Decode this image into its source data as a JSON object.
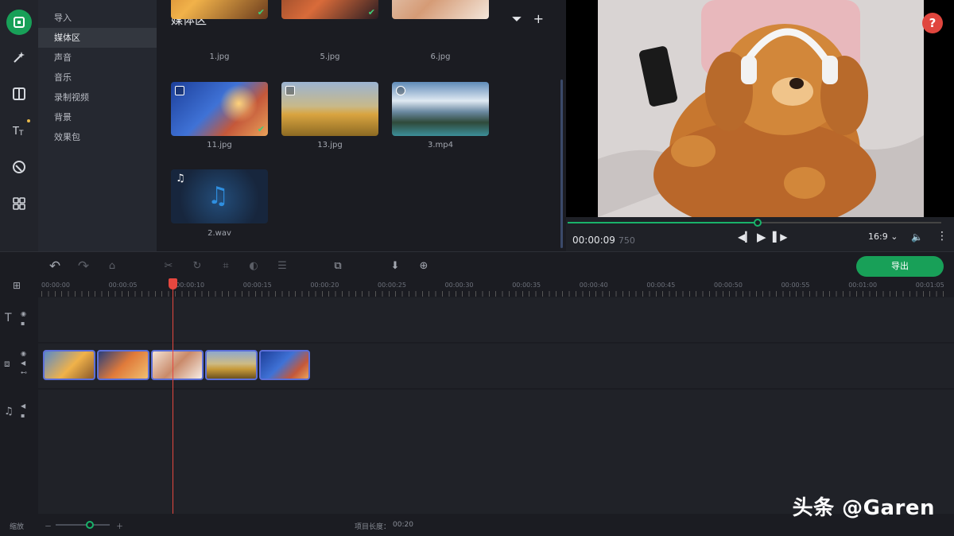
{
  "sidebar": {
    "categories": [
      "导入",
      "媒体区",
      "声音",
      "音乐",
      "录制视频",
      "背景",
      "效果包"
    ],
    "active_index": 1
  },
  "media": {
    "title": "媒体区",
    "items": [
      {
        "name": "1.jpg",
        "checked": true
      },
      {
        "name": "5.jpg",
        "checked": true
      },
      {
        "name": "6.jpg",
        "checked": false
      },
      {
        "name": "11.jpg",
        "checked": true
      },
      {
        "name": "13.jpg",
        "checked": false
      },
      {
        "name": "3.mp4",
        "checked": false
      },
      {
        "name": "2.wav",
        "checked": false
      }
    ]
  },
  "preview": {
    "time_current": "00:00:09",
    "time_sub": "750",
    "progress": 0.51,
    "aspect_ratio": "16:9",
    "help_label": "?"
  },
  "timeline": {
    "export_label": "导出",
    "ruler_labels": [
      "00:00:00",
      "00:00:05",
      "00:00:10",
      "00:00:15",
      "00:00:20",
      "00:00:25",
      "00:00:30",
      "00:00:35",
      "00:00:40",
      "00:00:45",
      "00:00:50",
      "00:00:55",
      "00:01:00",
      "00:01:05"
    ],
    "clip_count": 5
  },
  "footer": {
    "zoom_label": "缩放",
    "duration_label": "项目长度：",
    "duration_value": "00:20"
  },
  "watermark": "头条 @Garen",
  "colors": {
    "accent": "#18a058",
    "playhead": "#e5473f",
    "clip_border": "#5c6fd8",
    "help": "#e0463e"
  }
}
